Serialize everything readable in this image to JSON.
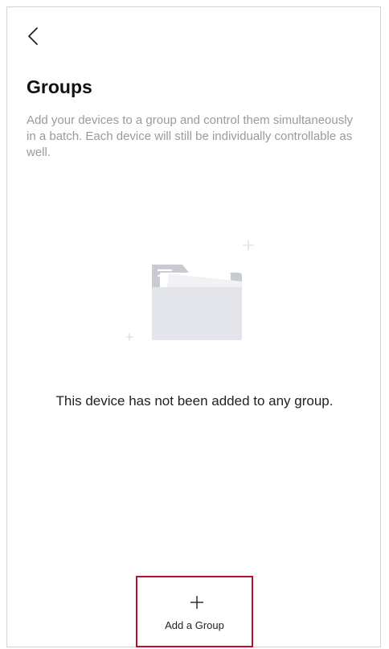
{
  "header": {
    "back_icon": "chevron-left-icon"
  },
  "page": {
    "title": "Groups",
    "description": "Add your devices to a group and control them simultaneously in a batch. Each device will still be individually controllable as well."
  },
  "empty_state": {
    "icon": "folder-icon",
    "message": "This device has not been added to any group."
  },
  "footer": {
    "add_group_icon": "plus-icon",
    "add_group_label": "Add a Group",
    "highlight_color": "#b6122c"
  }
}
